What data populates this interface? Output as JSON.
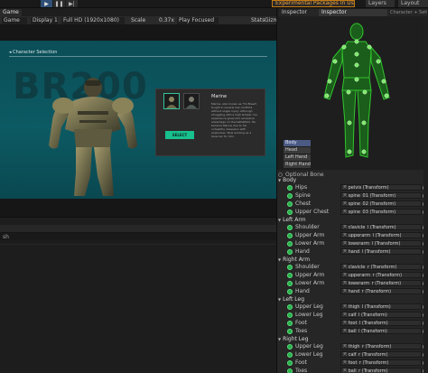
{
  "toolbar": {
    "play_icon": "play-icon",
    "pause_icon": "pause-icon",
    "step_icon": "step-icon",
    "experimental_packages": "Experimental Packages In Use",
    "layers": "Layers",
    "layout": "Layout",
    "accent_color": "#2f4f76",
    "warning_color": "#f2a23a"
  },
  "game": {
    "tab_label": "Game",
    "mode": "Game",
    "display": "Display 1",
    "resolution": "Full HD (1920x1080)",
    "scale_label": "Scale",
    "scale_value": "0.37x",
    "play_focused": "Play Focused",
    "stats": "Stats",
    "gizmos": "Gizmo",
    "view_bg_color": "#0b4e57",
    "scene": {
      "heading": "Character Selection",
      "bg_text": "BR200",
      "character_name": "Marine",
      "description": "Marine, also known as 'Tin Breed', fought in several war conflicts without single injury. Although struggling with a high temper, his experience gives him excessive advantage on the battlefield. He became Marine due to his unhealthy obsession with explosives. Now working as a taverner for him.",
      "select_button": "SELECT",
      "accent_color": "#18c08e"
    }
  },
  "console": {
    "search_text": "sh"
  },
  "inspector": {
    "tabs": [
      "Inspector",
      "Inspector"
    ],
    "header_text": "Character + Settings",
    "body_parts": [
      "Body",
      "Head",
      "Left Hand",
      "Right Hand"
    ],
    "selected_part": "Body",
    "optional_bone": "Optional Bone",
    "sections": [
      {
        "title": "Body",
        "bones": [
          {
            "name": "Hips",
            "transform": "pelvis (Transform)"
          },
          {
            "name": "Spine",
            "transform": "spine_01 (Transform)"
          },
          {
            "name": "Chest",
            "transform": "spine_02 (Transform)"
          },
          {
            "name": "Upper Chest",
            "transform": "spine_03 (Transform)"
          }
        ]
      },
      {
        "title": "Left Arm",
        "bones": [
          {
            "name": "Shoulder",
            "transform": "clavicle_l (Transform)"
          },
          {
            "name": "Upper Arm",
            "transform": "upperarm_l (Transform)"
          },
          {
            "name": "Lower Arm",
            "transform": "lowerarm_l (Transform)"
          },
          {
            "name": "Hand",
            "transform": "hand_l (Transform)"
          }
        ]
      },
      {
        "title": "Right Arm",
        "bones": [
          {
            "name": "Shoulder",
            "transform": "clavicle_r (Transform)"
          },
          {
            "name": "Upper Arm",
            "transform": "upperarm_r (Transform)"
          },
          {
            "name": "Lower Arm",
            "transform": "lowerarm_r (Transform)"
          },
          {
            "name": "Hand",
            "transform": "hand_r (Transform)"
          }
        ]
      },
      {
        "title": "Left Leg",
        "bones": [
          {
            "name": "Upper Leg",
            "transform": "thigh_l (Transform)"
          },
          {
            "name": "Lower Leg",
            "transform": "calf_l (Transform)"
          },
          {
            "name": "Foot",
            "transform": "foot_l (Transform)"
          },
          {
            "name": "Toes",
            "transform": "ball_l (Transform)"
          }
        ]
      },
      {
        "title": "Right Leg",
        "bones": [
          {
            "name": "Upper Leg",
            "transform": "thigh_r (Transform)"
          },
          {
            "name": "Lower Leg",
            "transform": "calf_r (Transform)"
          },
          {
            "name": "Foot",
            "transform": "foot_r (Transform)"
          },
          {
            "name": "Toes",
            "transform": "ball_r (Transform)"
          }
        ]
      }
    ],
    "bone_ok_color": "#26b14a",
    "avatar_color": "#31c52e"
  }
}
